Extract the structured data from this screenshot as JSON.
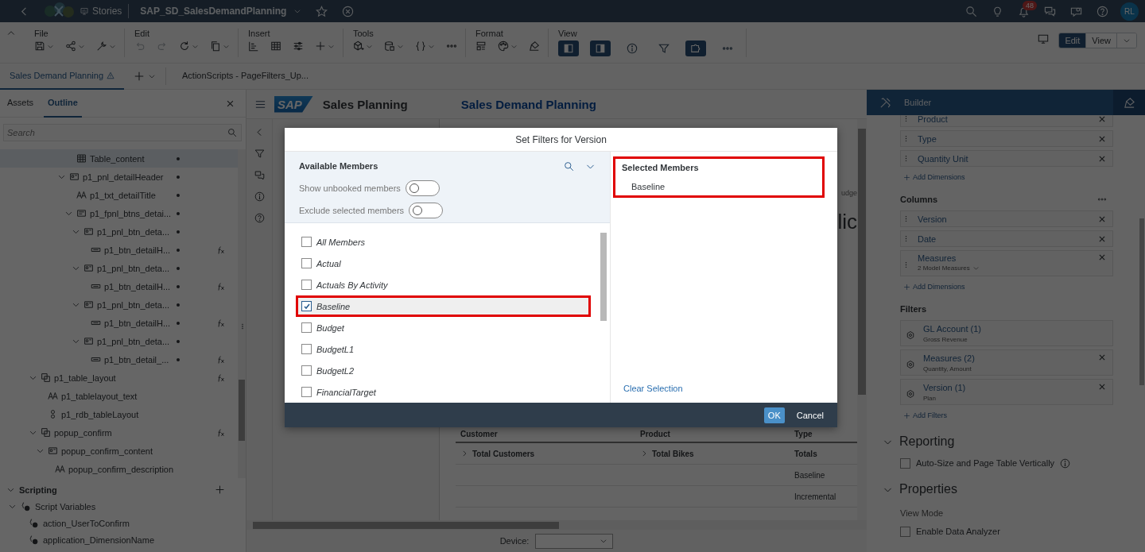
{
  "shell": {
    "app": "Stories",
    "story": "SAP_SD_SalesDemandPlanning",
    "notifications": "48",
    "avatar": "RL"
  },
  "toolbar": {
    "groups": [
      {
        "label": "File"
      },
      {
        "label": "Edit"
      },
      {
        "label": "Insert"
      },
      {
        "label": "Tools"
      },
      {
        "label": "Format"
      },
      {
        "label": "View",
        "toggles": [
          {
            "selected": true
          },
          {
            "selected": true
          },
          {
            "selected": false
          },
          {
            "selected": false
          },
          {
            "selected": true
          },
          {
            "selected": false
          }
        ]
      }
    ],
    "mode_buttons": [
      {
        "label": "Edit",
        "selected": true
      },
      {
        "label": "View",
        "selected": false
      }
    ]
  },
  "page_tabs": [
    {
      "label": "Sales Demand Planning",
      "selected": true,
      "warning": true
    },
    {
      "label": "ActionScripts - PageFilters_Up...",
      "selected": false,
      "warning": false
    }
  ],
  "left_panel": {
    "tabs": [
      {
        "label": "Assets",
        "selected": false
      },
      {
        "label": "Outline",
        "selected": true
      }
    ],
    "search": {
      "placeholder": "Search"
    },
    "outline": [
      {
        "children": [
          {
            "children": [
              {
                "children": [
                  {
                    "children": [
                      {
                        "children": [
                          {
                            "label": "Table_content",
                            "kind": "table",
                            "dot": true,
                            "script": false,
                            "selected": true
                          }
                        ]
                      },
                      {
                        "label": "p1_pnl_detailHeader",
                        "kind": "panel",
                        "dot": true,
                        "script": false,
                        "selected": false,
                        "expanded": true,
                        "children": [
                          {
                            "label": "p1_txt_detailTitle",
                            "kind": "text",
                            "dot": true,
                            "script": false,
                            "selected": false
                          },
                          {
                            "label": "p1_fpnl_btns_detai...",
                            "kind": "flow",
                            "dot": true,
                            "script": false,
                            "selected": false,
                            "expanded": true,
                            "children": [
                              {
                                "label": "p1_pnl_btn_deta...",
                                "kind": "panel",
                                "dot": true,
                                "script": false,
                                "selected": false,
                                "expanded": true,
                                "children": [
                                  {
                                    "label": "p1_btn_detailH...",
                                    "kind": "button",
                                    "dot": true,
                                    "script": true,
                                    "selected": false
                                  }
                                ]
                              },
                              {
                                "label": "p1_pnl_btn_deta...",
                                "kind": "panel",
                                "dot": true,
                                "script": false,
                                "selected": false,
                                "expanded": true,
                                "children": [
                                  {
                                    "label": "p1_btn_detailH...",
                                    "kind": "button",
                                    "dot": true,
                                    "script": true,
                                    "selected": false
                                  }
                                ]
                              },
                              {
                                "label": "p1_pnl_btn_deta...",
                                "kind": "panel",
                                "dot": true,
                                "script": false,
                                "selected": false,
                                "expanded": true,
                                "children": [
                                  {
                                    "label": "p1_btn_detailH...",
                                    "kind": "button",
                                    "dot": true,
                                    "script": true,
                                    "selected": false
                                  }
                                ]
                              },
                              {
                                "label": "p1_pnl_btn_deta...",
                                "kind": "panel",
                                "dot": true,
                                "script": false,
                                "selected": false,
                                "expanded": true,
                                "children": [
                                  {
                                    "label": "p1_btn_detail_...",
                                    "kind": "button",
                                    "dot": true,
                                    "script": true,
                                    "selected": false
                                  }
                                ]
                              }
                            ]
                          }
                        ]
                      }
                    ]
                  }
                ]
              }
            ]
          }
        ]
      },
      {
        "label": "p1_table_layout",
        "kind": "container",
        "dot": false,
        "script": true,
        "selected": false,
        "expanded": true,
        "children": [
          {
            "label": "p1_tablelayout_text",
            "kind": "text",
            "dot": false,
            "script": false,
            "selected": false
          },
          {
            "label": "p1_rdb_tableLayout",
            "kind": "radio",
            "dot": false,
            "script": false,
            "selected": false
          }
        ]
      },
      {
        "label": "popup_confirm",
        "kind": "container",
        "dot": false,
        "script": true,
        "selected": false,
        "expanded": true,
        "children": [
          {
            "label": "popup_confirm_content",
            "kind": "panel",
            "dot": false,
            "script": false,
            "selected": false,
            "expanded": true,
            "children": [
              {
                "label": "popup_confirm_description",
                "kind": "text",
                "dot": false,
                "script": false,
                "selected": false
              }
            ]
          }
        ]
      }
    ],
    "scripting": {
      "title": "Scripting",
      "expanded": true,
      "items": [
        {
          "label": "Script Variables",
          "expanded": true,
          "children": [
            {
              "label": "action_UserToConfirm"
            },
            {
              "label": "application_DimensionName"
            }
          ]
        }
      ]
    }
  },
  "canvas": {
    "app_title": "Sales Planning",
    "logo": "SAP",
    "page_title": "Sales Demand Planning",
    "fragments": [
      "udge",
      "lic"
    ],
    "table": {
      "columns": [
        "Customer",
        "Product",
        "Type"
      ],
      "rows": [
        [
          "Total Customers",
          "Total Bikes",
          "Totals"
        ],
        [
          "",
          "",
          "Baseline"
        ],
        [
          "",
          "",
          "Incremental"
        ]
      ]
    },
    "device": {
      "label": "Device:"
    }
  },
  "builder": {
    "title": "Builder",
    "rows": [
      {
        "label": "Product"
      },
      {
        "label": "Type"
      },
      {
        "label": "Quantity Unit"
      }
    ],
    "rows_add": "Add Dimensions",
    "columns_title": "Columns",
    "columns": [
      {
        "label": "Version"
      },
      {
        "label": "Date"
      },
      {
        "label": "Measures",
        "sub": "2 Model Measures"
      }
    ],
    "columns_add": "Add Dimensions",
    "filters_title": "Filters",
    "filters": [
      {
        "label": "GL Account (1)",
        "sub": "Gross Revenue",
        "removable": false
      },
      {
        "label": "Measures (2)",
        "sub": "Quantity, Amount",
        "removable": true
      },
      {
        "label": "Version (1)",
        "sub": "Plan",
        "removable": true
      }
    ],
    "filters_add": "Add Filters",
    "reporting": {
      "title": "Reporting",
      "expanded": true,
      "option": {
        "label": "Auto-Size and Page Table Vertically",
        "checked": false
      }
    },
    "properties": {
      "title": "Properties",
      "expanded": true,
      "view_mode": "View Mode",
      "option": {
        "label": "Enable Data Analyzer",
        "checked": false
      }
    }
  },
  "dialog": {
    "title": "Set Filters for Version",
    "available_title": "Available Members",
    "toggles": [
      {
        "label": "Show unbooked members",
        "on": false
      },
      {
        "label": "Exclude selected members",
        "on": false
      }
    ],
    "members": [
      {
        "label": "All Members",
        "checked": false,
        "highlighted": false
      },
      {
        "label": "Actual",
        "checked": false,
        "highlighted": false
      },
      {
        "label": "Actuals By Activity",
        "checked": false,
        "highlighted": false
      },
      {
        "label": "Baseline",
        "checked": true,
        "highlighted": true
      },
      {
        "label": "Budget",
        "checked": false,
        "highlighted": false
      },
      {
        "label": "BudgetL1",
        "checked": false,
        "highlighted": false
      },
      {
        "label": "BudgetL2",
        "checked": false,
        "highlighted": false
      },
      {
        "label": "FinancialTarget",
        "checked": false,
        "highlighted": false
      }
    ],
    "selected_title": "Selected Members",
    "selected_highlighted": true,
    "selected": [
      "Baseline"
    ],
    "clear": "Clear Selection",
    "buttons": [
      {
        "label": "OK",
        "kind": "primary"
      },
      {
        "label": "Cancel",
        "kind": "secondary"
      }
    ]
  }
}
